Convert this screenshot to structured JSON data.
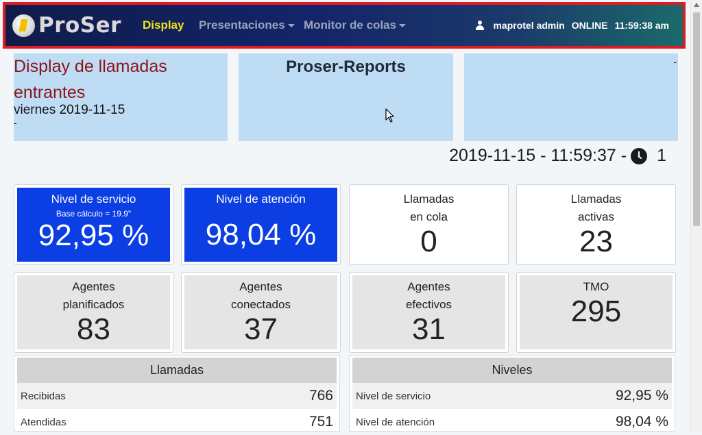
{
  "navbar": {
    "logo_text": "ProSer",
    "items": [
      {
        "label": "Display"
      },
      {
        "label": "Presentaciones"
      },
      {
        "label": "Monitor de colas"
      }
    ],
    "user": "maprotel admin",
    "status": "ONLINE",
    "time": "11:59:38 am",
    "highlight_color": "#e01b24",
    "active_color": "#f5e417"
  },
  "header": {
    "title": "Display de llamadas entrantes",
    "date": "viernes 2019-11-15",
    "dash_left": "-",
    "center_title": "Proser-Reports",
    "dash_right": "-"
  },
  "timestamp": {
    "text": "2019-11-15 - 11:59:37 -",
    "counter": "1",
    "icon": "clock-icon"
  },
  "cards": [
    {
      "label": "Nivel de servicio",
      "sub": "Base cálculo = 19.9\"",
      "value": "92,95 %"
    },
    {
      "label": "Nivel de atención",
      "value": "98,04 %"
    },
    {
      "label_line1": "Llamadas",
      "label_line2": "en cola",
      "value": "0"
    },
    {
      "label_line1": "Llamadas",
      "label_line2": "activas",
      "value": "23"
    },
    {
      "label_line1": "Agentes",
      "label_line2": "planificados",
      "value": "83"
    },
    {
      "label_line1": "Agentes",
      "label_line2": "conectados",
      "value": "37"
    },
    {
      "label_line1": "Agentes",
      "label_line2": "efectivos",
      "value": "31"
    },
    {
      "label_line1": "TMO",
      "label_line2": "",
      "value": "295"
    }
  ],
  "llamadas": {
    "title": "Llamadas",
    "rows": [
      {
        "label": "Recibidas",
        "value": "766"
      },
      {
        "label": "Atendidas",
        "value": "751"
      }
    ]
  },
  "niveles": {
    "title": "Niveles",
    "rows": [
      {
        "label": "Nivel de servicio",
        "value": "92,95 %"
      },
      {
        "label": "Nivel de atención",
        "value": "98,04 %"
      }
    ]
  }
}
